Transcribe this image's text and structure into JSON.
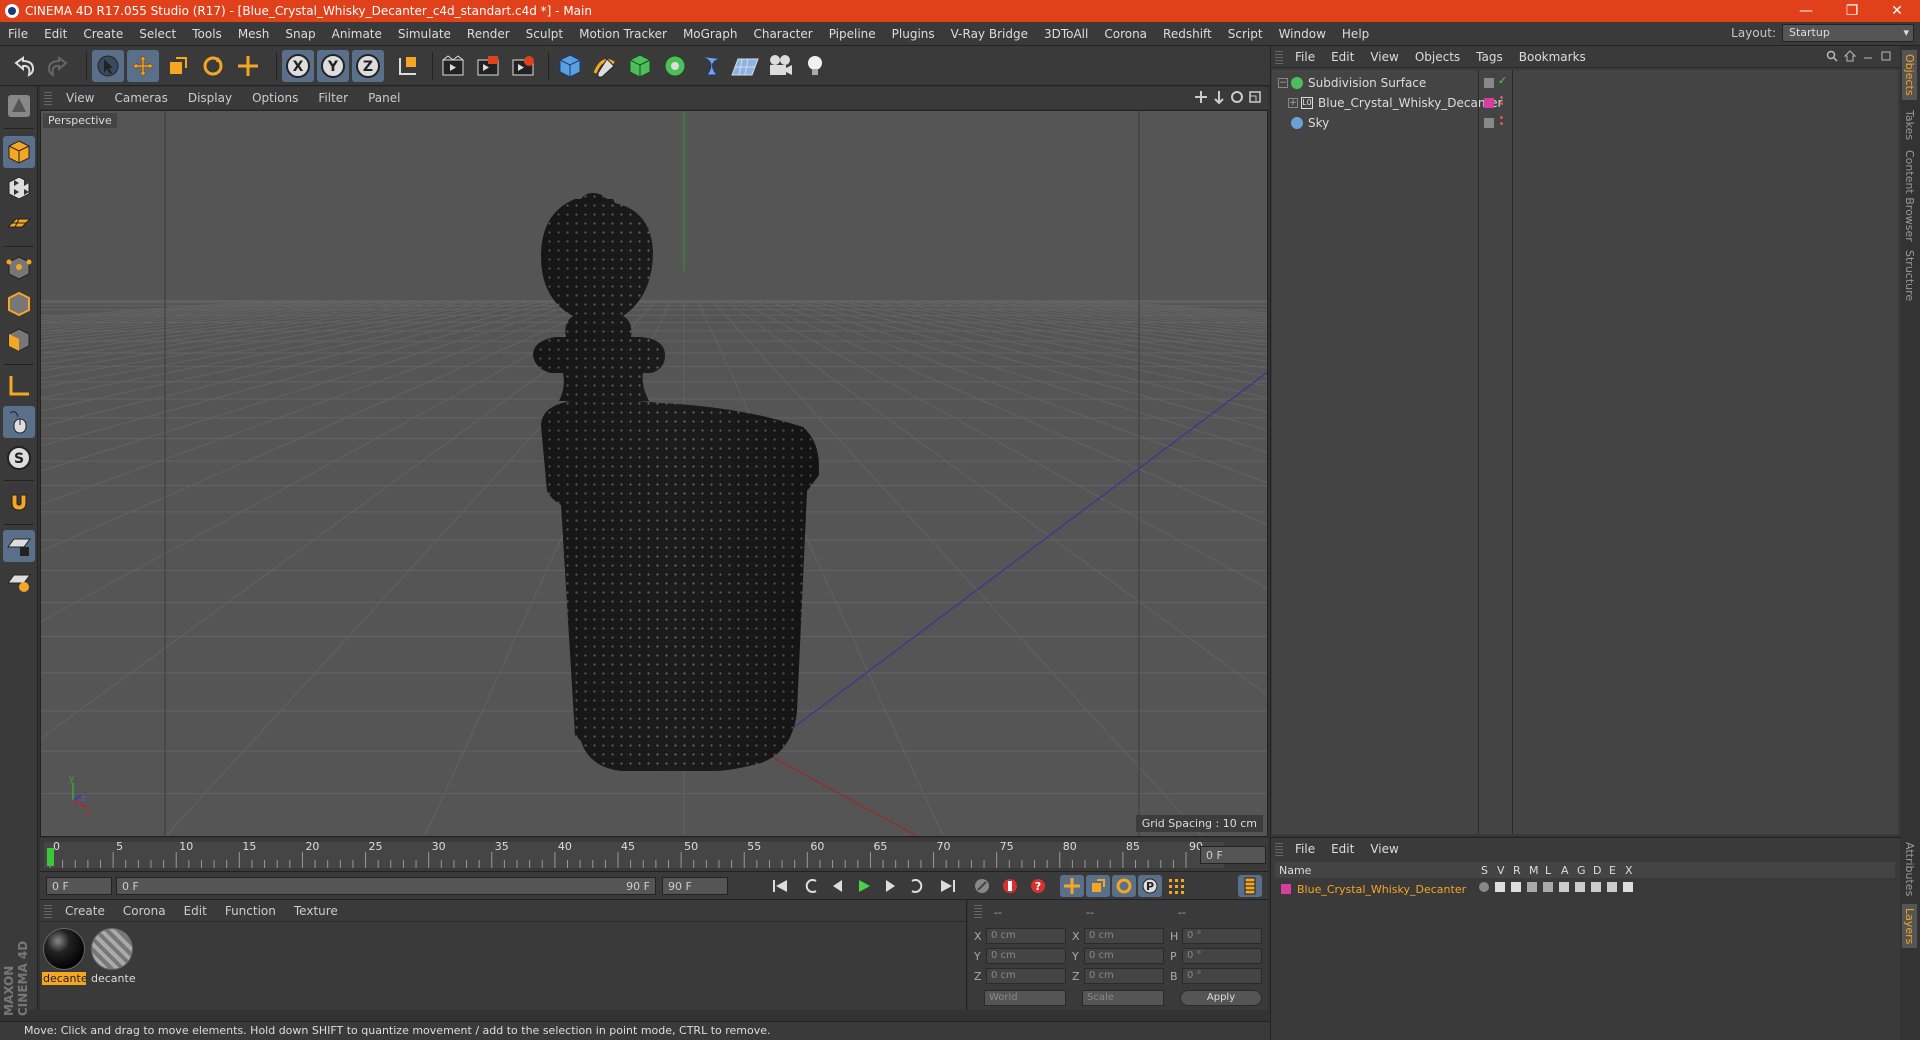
{
  "window": {
    "title": "CINEMA 4D R17.055 Studio (R17) - [Blue_Crystal_Whisky_Decanter_c4d_standart.c4d *] - Main",
    "controls": [
      "—",
      "❐",
      "✕"
    ]
  },
  "menu": {
    "items": [
      "File",
      "Edit",
      "Create",
      "Select",
      "Tools",
      "Mesh",
      "Snap",
      "Animate",
      "Simulate",
      "Render",
      "Sculpt",
      "Motion Tracker",
      "MoGraph",
      "Character",
      "Pipeline",
      "Plugins",
      "V-Ray Bridge",
      "3DToAll",
      "Corona",
      "Redshift",
      "Script",
      "Window",
      "Help"
    ],
    "layout_label": "Layout:",
    "layout_value": "Startup"
  },
  "viewport": {
    "menu": [
      "View",
      "Cameras",
      "Display",
      "Options",
      "Filter",
      "Panel"
    ],
    "label": "Perspective",
    "grid_spacing": "Grid Spacing : 10 cm",
    "colors": {
      "bg": "#555555",
      "grid": "#606060",
      "x_axis": "#b02020",
      "y_axis": "#20a020",
      "z_axis": "#2030b0",
      "model": "#1e1e1e"
    }
  },
  "timeline": {
    "ticks": [
      "0",
      "5",
      "10",
      "15",
      "20",
      "25",
      "30",
      "35",
      "40",
      "45",
      "50",
      "55",
      "60",
      "65",
      "70",
      "75",
      "80",
      "85",
      "90"
    ],
    "current": "0 F",
    "start": "0 F",
    "range_start": "0 F",
    "range_end": "90 F",
    "end": "90 F"
  },
  "materials": {
    "menu": [
      "Create",
      "Corona",
      "Edit",
      "Function",
      "Texture"
    ],
    "items": [
      {
        "name": "decante",
        "selected": true
      },
      {
        "name": "decante",
        "selected": false
      }
    ]
  },
  "coords": {
    "headers": [
      "--",
      "--",
      "--"
    ],
    "rows": [
      {
        "a": "X",
        "av": "0 cm",
        "b": "X",
        "bv": "0 cm",
        "c": "H",
        "cv": "0 °"
      },
      {
        "a": "Y",
        "av": "0 cm",
        "b": "Y",
        "bv": "0 cm",
        "c": "P",
        "cv": "0 °"
      },
      {
        "a": "Z",
        "av": "0 cm",
        "b": "Z",
        "bv": "0 cm",
        "c": "B",
        "cv": "0 °"
      }
    ],
    "mode1": "World",
    "mode2": "Scale",
    "apply": "Apply"
  },
  "status": "Move: Click and drag to move elements. Hold down SHIFT to quantize movement / add to the selection in point mode, CTRL to remove.",
  "brand": "MAXON CINEMA 4D",
  "objects": {
    "menu": [
      "File",
      "Edit",
      "View",
      "Objects",
      "Tags",
      "Bookmarks"
    ],
    "items": [
      {
        "name": "Subdivision Surface",
        "color": "#4cbf5c"
      },
      {
        "name": "Blue_Crystal_Whisky_Decanter",
        "color": "#d63fa0"
      },
      {
        "name": "Sky",
        "color": "#6aa0d8"
      }
    ]
  },
  "layers": {
    "menu": [
      "File",
      "Edit",
      "View"
    ],
    "columns": [
      "Name",
      "S",
      "V",
      "R",
      "M",
      "L",
      "A",
      "G",
      "D",
      "E",
      "X"
    ],
    "items": [
      {
        "name": "Blue_Crystal_Whisky_Decanter",
        "color": "#d63fa0"
      }
    ]
  },
  "side_tabs": [
    "Objects",
    "Takes",
    "Content Browser",
    "Structure"
  ],
  "side_tabs_bottom": [
    "Attributes",
    "Layers"
  ]
}
